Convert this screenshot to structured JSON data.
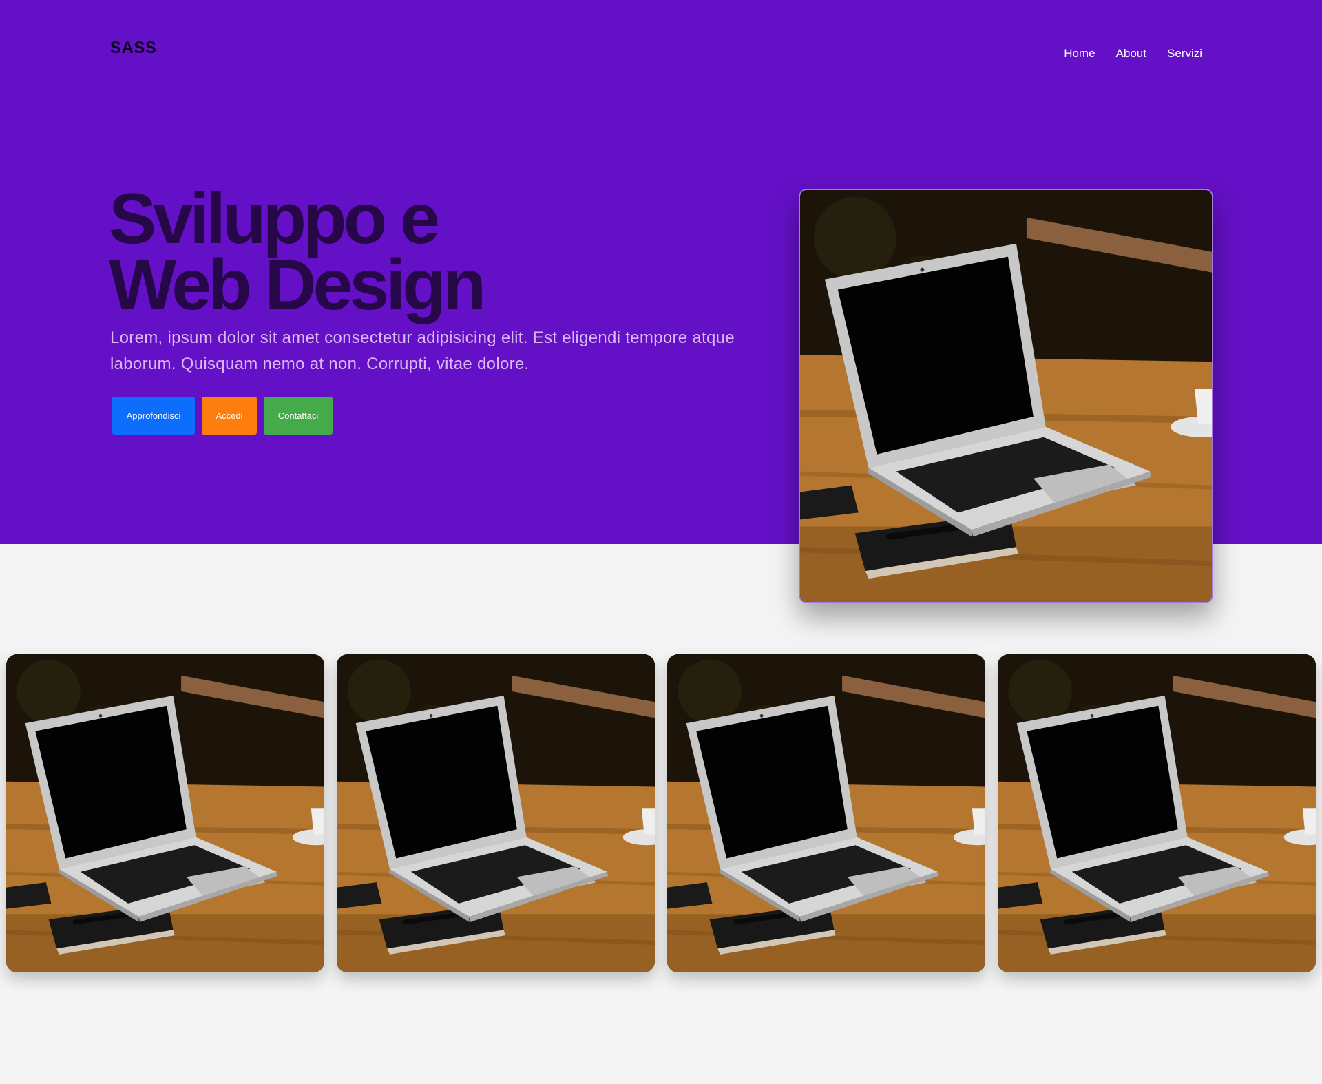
{
  "header": {
    "logo": "SASS",
    "nav": [
      {
        "label": "Home"
      },
      {
        "label": "About"
      },
      {
        "label": "Servizi"
      }
    ]
  },
  "hero": {
    "title_line1": "Sviluppo e",
    "title_line2": "Web Design",
    "lead": "Lorem, ipsum dolor sit amet consectetur adipisicing elit. Est eligendi tempore atque laborum. Quisquam nemo at non. Corrupti, vitae dolore.",
    "buttons": [
      {
        "label": "Approfondisci",
        "color": "#0d6efd"
      },
      {
        "label": "Accedi",
        "color": "#fd7e0e"
      },
      {
        "label": "Contattaci",
        "color": "#45aa4a"
      }
    ],
    "image": "laptop-on-wooden-table-photo"
  },
  "gallery": {
    "images": [
      "laptop-on-wooden-table-photo",
      "laptop-on-wooden-table-photo",
      "laptop-on-wooden-table-photo",
      "laptop-on-wooden-table-photo"
    ]
  },
  "colors": {
    "hero_background": "#6410c6",
    "page_background": "#f4f4f4",
    "headline": "#260848"
  }
}
